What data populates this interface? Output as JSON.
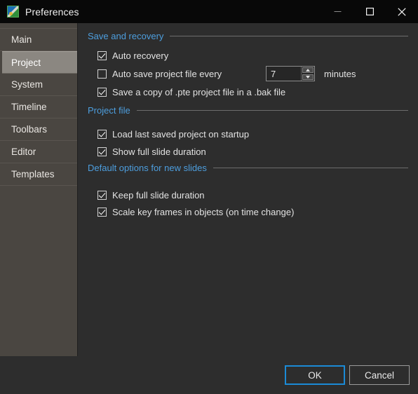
{
  "window": {
    "title": "Preferences",
    "icon": "app-picture-icon",
    "controls": {
      "minimize": "minimize-icon",
      "maximize": "maximize-icon",
      "close": "close-icon"
    }
  },
  "colors": {
    "accent_heading": "#4d9ede",
    "focus_border": "#1b8ad6",
    "titlebar_bg": "#080808",
    "body_bg": "#2d2d2d",
    "sidebar_bg": "#4a4641",
    "sidebar_selected_bg": "#8b8781"
  },
  "sidebar": {
    "items": [
      {
        "label": "Main",
        "selected": false
      },
      {
        "label": "Project",
        "selected": true
      },
      {
        "label": "System",
        "selected": false
      },
      {
        "label": "Timeline",
        "selected": false
      },
      {
        "label": "Toolbars",
        "selected": false
      },
      {
        "label": "Editor",
        "selected": false
      },
      {
        "label": "Templates",
        "selected": false
      }
    ]
  },
  "groups": [
    {
      "title": "Save and recovery",
      "rows": [
        {
          "label": "Auto recovery",
          "checked": true
        },
        {
          "label": "Auto save project file every",
          "checked": false
        },
        {
          "label": "Save a copy of .pte project file in a .bak file",
          "checked": true
        }
      ]
    },
    {
      "title": "Project file",
      "rows": [
        {
          "label": "Load last saved project on startup",
          "checked": true
        },
        {
          "label": "Show full slide duration",
          "checked": true
        }
      ]
    },
    {
      "title": "Default options for new slides",
      "rows": [
        {
          "label": "Keep full slide duration",
          "checked": true
        },
        {
          "label": "Scale key frames in objects (on time change)",
          "checked": true
        }
      ]
    }
  ],
  "autosave_spinner": {
    "value": "7",
    "unit_label": "minutes"
  },
  "footer": {
    "ok_label": "OK",
    "cancel_label": "Cancel"
  }
}
